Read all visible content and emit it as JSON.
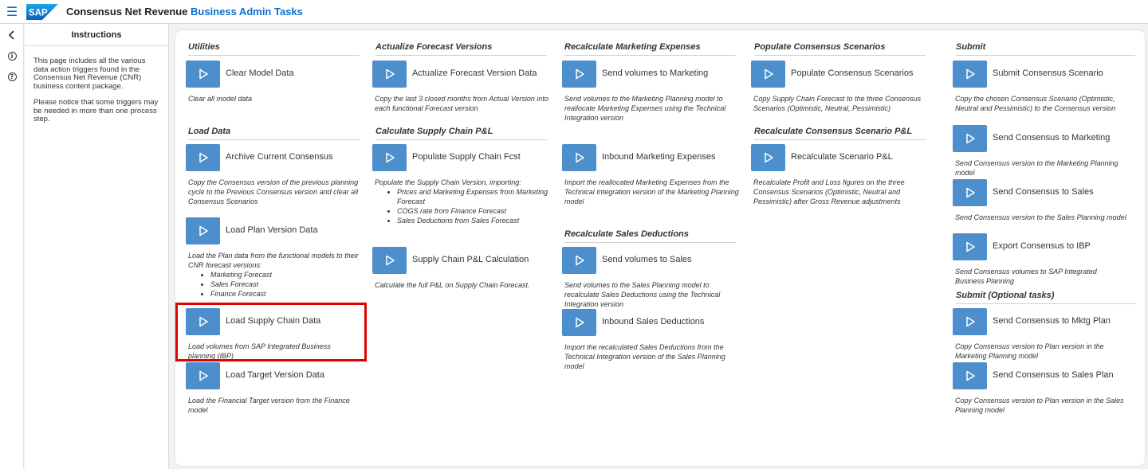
{
  "shell": {
    "logo_text": "SAP",
    "app_title": "Consensus Net Revenue",
    "page_name": "Business Admin Tasks"
  },
  "left_rail": {
    "collapse_icon": "chevron-left-icon",
    "info_icon": "info-icon",
    "help_icon": "help-icon"
  },
  "instructions": {
    "title": "Instructions",
    "paragraphs": [
      "This page includes all the various data action triggers found in the Consensus Net Revenue (CNR) business content package.",
      "Please notice that some triggers may be needed in more than one process step."
    ]
  },
  "colors": {
    "accent": "#0a6ed1",
    "button": "#4d8fcc",
    "highlight": "#e00000"
  },
  "sections": {
    "utilities": "Utilities",
    "load_data": "Load Data",
    "actualize": "Actualize Forecast Versions",
    "calc_supply": "Calculate Supply Chain P&L",
    "recalc_marketing": "Recalculate Marketing Expenses",
    "recalc_sales": "Recalculate Sales Deductions",
    "populate": "Populate Consensus Scenarios",
    "recalc_consensus": "Recalculate Consensus Scenario P&L",
    "submit": "Submit",
    "submit_optional": "Submit (Optional tasks)"
  },
  "tasks": {
    "clear_model": {
      "label": "Clear Model Data",
      "desc": "Clear all model data"
    },
    "archive": {
      "label": "Archive Current Consensus",
      "desc": "Copy the Consensus version of the previous planning cycle to the Previous Consensus version and clear all Consensus Scenarios"
    },
    "load_plan": {
      "label": "Load Plan Version Data",
      "desc": "Load the Plan data from the functional models to their CNR forecast versions:",
      "bullets": [
        "Marketing Forecast",
        "Sales Forecast",
        "Finance Forecast"
      ]
    },
    "load_supply": {
      "label": "Load Supply Chain Data",
      "desc": "Load volumes from SAP Integrated Business planning (IBP)"
    },
    "load_target": {
      "label": "Load Target Version Data",
      "desc": "Load the Financial Target version from the Finance model"
    },
    "actualize": {
      "label": "Actualize Forecast Version Data",
      "desc": "Copy the last 3 closed months from Actual Version into each functional Forecast version"
    },
    "populate_supply": {
      "label": "Populate Supply Chain Fcst",
      "desc": "Populate the Supply Chain Version, importing:",
      "bullets": [
        "Prices and Marketing Expenses from Marketing Forecast",
        "COGS rate from Finance Forecast",
        "Sales Deductions from Sales Forecast"
      ]
    },
    "supply_calc": {
      "label": "Supply Chain P&L Calculation",
      "desc": "Calculate the full P&L on Supply Chain Forecast."
    },
    "send_vol_marketing": {
      "label": "Send volumes to Marketing",
      "desc": "Send volumes to the Marketing Planning model to reallocate Marketing Expenses using the Technical Integration version"
    },
    "inbound_marketing": {
      "label": "Inbound Marketing Expenses",
      "desc": "Import the reallocated Marketing Expenses from the Technical Integration version of the Marketing Planning model"
    },
    "send_vol_sales": {
      "label": "Send volumes to Sales",
      "desc": "Send volumes to the Sales Planning model to recalculate Sales Deductions using the Technical Integration version"
    },
    "inbound_sales": {
      "label": "Inbound Sales Deductions",
      "desc": "Import the recalculated Sales Deductions from the Technical Integration version of the Sales Planning model"
    },
    "populate_consensus": {
      "label": "Populate Consensus Scenarios",
      "desc": "Copy Supply Chain Forecast to the three Consensus Scenarios (Optimistic, Neutral, Pessimistic)"
    },
    "recalc_scenario": {
      "label": "Recalculate Scenario P&L",
      "desc": "Recalculate Profit and Loss figures on the three Consensus Scenarios (Optimistic, Neutral and Pessimistic) after Gross Revenue adjustments"
    },
    "submit_consensus": {
      "label": "Submit Consensus Scenario",
      "desc": "Copy the chosen Consensus Scenario (Optimistic, Neutral and Pessimistic) to the Consensus version"
    },
    "send_cons_marketing": {
      "label": "Send Consensus to Marketing",
      "desc": "Send Consensus version to the Marketing Planning model"
    },
    "send_cons_sales": {
      "label": "Send Consensus to Sales",
      "desc": "Send Consensus version to the Sales Planning model"
    },
    "export_ibp": {
      "label": "Export Consensus to IBP",
      "desc": "Send Consensus volumes to SAP Integrated Business Planning"
    },
    "send_mktg_plan": {
      "label": "Send Consensus to Mktg Plan",
      "desc": "Copy Consensus version to Plan version in the Marketing Planning model"
    },
    "send_sales_plan": {
      "label": "Send Consensus to Sales Plan",
      "desc": "Copy Consensus version to Plan version in the Sales Planning model"
    }
  }
}
